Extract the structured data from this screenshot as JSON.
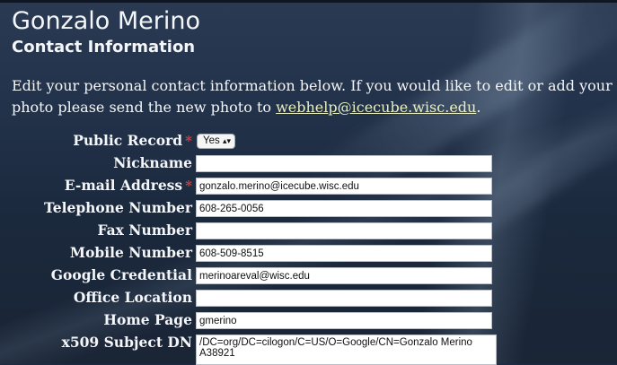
{
  "header": {
    "name": "Gonzalo Merino",
    "section_title": "Contact Information"
  },
  "intro": {
    "text_before": "Edit your personal contact information below. If you would like to edit or add your photo please send the new photo to ",
    "email_link": "webhelp@icecube.wisc.edu",
    "text_after": "."
  },
  "form": {
    "public_record": {
      "label": "Public Record",
      "required_mark": "*",
      "value": "Yes",
      "arrow": "▴▾"
    },
    "nickname": {
      "label": "Nickname",
      "value": ""
    },
    "email": {
      "label": "E-mail Address",
      "required_mark": "*",
      "value": "gonzalo.merino@icecube.wisc.edu"
    },
    "telephone": {
      "label": "Telephone Number",
      "value": "608-265-0056"
    },
    "fax": {
      "label": "Fax Number",
      "value": ""
    },
    "mobile": {
      "label": "Mobile Number",
      "value": "608-509-8515"
    },
    "google": {
      "label": "Google Credential",
      "value": "merinoareval@wisc.edu"
    },
    "office": {
      "label": "Office Location",
      "value": ""
    },
    "homepage": {
      "label": "Home Page",
      "value": "gmerino"
    },
    "x509": {
      "label": "x509 Subject DN",
      "value": "/DC=org/DC=cilogon/C=US/O=Google/CN=Gonzalo Merino A38921"
    }
  },
  "colors": {
    "background": "#1d2c42",
    "required": "#e03a3a",
    "link": "#e9efc0",
    "text": "#f4f6f9"
  }
}
